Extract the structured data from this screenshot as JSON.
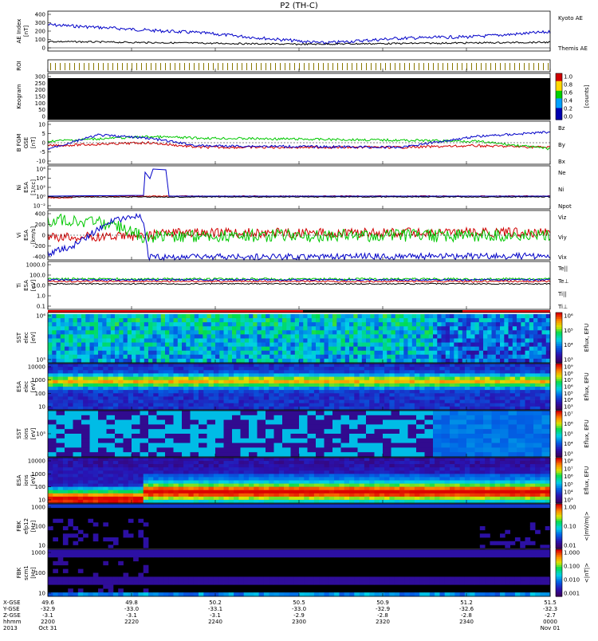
{
  "title": "P2 (TH-C)",
  "colors": {
    "red": "#d00000",
    "green": "#00c800",
    "blue": "#0000c8",
    "black": "#000000"
  },
  "panels": [
    {
      "id": "ae",
      "ylabel": [
        "AE Index",
        "[nT]"
      ],
      "ticks": [
        "400",
        "300",
        "200",
        "100",
        "0"
      ],
      "legend": [
        {
          "text": "Kyoto AE",
          "color": "#0000c8"
        },
        {
          "text": "Themis AE",
          "color": "#000000"
        }
      ]
    },
    {
      "id": "roi",
      "ylabel": [
        "ROI"
      ],
      "ticks": [],
      "legend": []
    },
    {
      "id": "keogram",
      "ylabel": [
        "Keogram"
      ],
      "ticks": [
        "300",
        "250",
        "200",
        "150",
        "100",
        "50",
        "0"
      ],
      "cbar_ticks": [
        "1.0",
        "0.8",
        "0.6",
        "0.4",
        "0.2",
        "0.0"
      ],
      "cbar_label": "[counts]",
      "legend": []
    },
    {
      "id": "bfgm",
      "ylabel": [
        "B FGM",
        "GSE",
        "[nT]"
      ],
      "ticks": [
        "10",
        "5",
        "0",
        "-5",
        "-10"
      ],
      "legend": [
        {
          "text": "Bz",
          "color": "#d00000"
        },
        {
          "text": "By",
          "color": "#00c800"
        },
        {
          "text": "Bx",
          "color": "#0000c8"
        }
      ]
    },
    {
      "id": "ni",
      "ylabel": [
        "Ni",
        "ESA",
        "[1/cc]"
      ],
      "ticks": [
        "10⁶",
        "10⁴",
        "10²",
        "10⁰",
        "10⁻²"
      ],
      "legend": [
        {
          "text": "Ne",
          "color": "#d00000"
        },
        {
          "text": "Ni",
          "color": "#000000"
        },
        {
          "text": "Npot",
          "color": "#0000c8"
        }
      ]
    },
    {
      "id": "vi",
      "ylabel": [
        "Vi",
        "ESA",
        "[km/s]"
      ],
      "ticks": [
        "400",
        "200",
        "0",
        "-200",
        "-400"
      ],
      "legend": [
        {
          "text": "Viz",
          "color": "#d00000"
        },
        {
          "text": "Viy",
          "color": "#00c800"
        },
        {
          "text": "Vix",
          "color": "#0000c8"
        }
      ]
    },
    {
      "id": "ti",
      "ylabel": [
        "Ti",
        "ESA",
        "[eV]"
      ],
      "ticks": [
        "1000.0",
        "100.0",
        "10.0",
        "1.0",
        "0.1"
      ],
      "legend": [
        {
          "text": "Te||",
          "color": "#000000"
        },
        {
          "text": "Te⊥",
          "color": "#d00000"
        },
        {
          "text": "Ti||",
          "color": "#00c800"
        },
        {
          "text": "Ti⊥",
          "color": "#0000c8"
        }
      ]
    },
    {
      "id": "sst_e",
      "ylabel": [
        "SST",
        "elec",
        "[eV]"
      ],
      "ticks": [
        "10⁶",
        "10⁵"
      ],
      "cbar_ticks": [
        "10⁶",
        "10⁵",
        "10⁴",
        "10³"
      ],
      "cbar_label": "Eflux, EFU",
      "legend": []
    },
    {
      "id": "esa_e",
      "ylabel": [
        "ESA",
        "elec",
        "[eV]"
      ],
      "ticks": [
        "10000",
        "1000",
        "100",
        "10"
      ],
      "cbar_ticks": [
        "10⁹",
        "10⁸",
        "10⁷",
        "10⁶",
        "10⁵",
        "10⁴",
        "10³"
      ],
      "cbar_label": "Eflux, EFU",
      "legend": []
    },
    {
      "id": "sst_i",
      "ylabel": [
        "SST",
        "ions",
        "[eV]"
      ],
      "ticks": [
        "10⁵"
      ],
      "cbar_ticks": [
        "10⁷",
        "10⁶",
        "10⁵",
        "10⁴",
        "10³"
      ],
      "cbar_label": "Eflux, EFU",
      "legend": []
    },
    {
      "id": "esa_i",
      "ylabel": [
        "ESA",
        "ions",
        "[eV]"
      ],
      "ticks": [
        "10000",
        "1000",
        "100",
        "10"
      ],
      "cbar_ticks": [
        "10⁸",
        "10⁷",
        "10⁶",
        "10⁵",
        "10⁴",
        "10³"
      ],
      "cbar_label": "Eflux, EFU",
      "legend": []
    },
    {
      "id": "fbk_e",
      "ylabel": [
        "FBK",
        "efp12",
        "[Hz]"
      ],
      "ticks": [
        "1000",
        "100",
        "10"
      ],
      "cbar_ticks": [
        "1.00",
        "0.10",
        "0.01"
      ],
      "cbar_label": "<|mV/m|>",
      "legend": []
    },
    {
      "id": "fbk_b",
      "ylabel": [
        "FBK",
        "scm1",
        "[Hz]"
      ],
      "ticks": [
        "1000",
        "100",
        "10"
      ],
      "cbar_ticks": [
        "1.000",
        "0.100",
        "0.010",
        "0.001"
      ],
      "cbar_label": "<|nT|>",
      "legend": []
    }
  ],
  "xaxis": {
    "row_labels": [
      "X-GSE",
      "Y-GSE",
      "Z-GSE",
      "hhmm",
      "2013"
    ],
    "columns": [
      [
        "49.6",
        "-32.9",
        "-3.1",
        "2200",
        "Oct 31"
      ],
      [
        "49.8",
        "-33.0",
        "-3.1",
        "2220",
        ""
      ],
      [
        "50.2",
        "-33.1",
        "-3.1",
        "2240",
        ""
      ],
      [
        "50.5",
        "-33.0",
        "-2.9",
        "2300",
        ""
      ],
      [
        "50.9",
        "-32.9",
        "-2.8",
        "2320",
        ""
      ],
      [
        "51.2",
        "-32.6",
        "-2.8",
        "2340",
        ""
      ],
      [
        "51.5",
        "-32.3",
        "-2.7",
        "0000",
        "Nov 01"
      ]
    ]
  },
  "chart_data": {
    "type": "line",
    "title": "P2 (TH-C)",
    "x_unit": "UT hhmm",
    "x_ticks": [
      "2200",
      "2220",
      "2240",
      "2300",
      "2320",
      "2340",
      "0000"
    ],
    "series": [
      {
        "panel": "AE Index",
        "name": "Kyoto AE",
        "x": [
          "2200",
          "2220",
          "2240",
          "2300",
          "2320",
          "2340",
          "0000"
        ],
        "values": [
          290,
          210,
          120,
          60,
          110,
          130,
          190
        ]
      },
      {
        "panel": "AE Index",
        "name": "Themis AE",
        "x": [
          "2200",
          "2220",
          "2240",
          "2300",
          "2320",
          "2340",
          "0000"
        ],
        "values": [
          80,
          70,
          60,
          40,
          60,
          60,
          70
        ]
      },
      {
        "panel": "B FGM",
        "name": "Bz",
        "x": [
          "2200",
          "2220",
          "2240",
          "2300",
          "2320",
          "2340",
          "0000"
        ],
        "values": [
          -1,
          -2,
          -3,
          -3,
          -3,
          -4,
          -2
        ]
      },
      {
        "panel": "B FGM",
        "name": "By",
        "x": [
          "2200",
          "2220",
          "2240",
          "2300",
          "2320",
          "2340",
          "0000"
        ],
        "values": [
          2,
          3,
          2,
          1,
          1,
          0,
          -4
        ]
      },
      {
        "panel": "B FGM",
        "name": "Bx",
        "x": [
          "2200",
          "2220",
          "2240",
          "2300",
          "2320",
          "2340",
          "0000"
        ],
        "values": [
          -2,
          -3,
          -3,
          -3,
          -2,
          3,
          6
        ]
      },
      {
        "panel": "Vi",
        "name": "Vix",
        "x": [
          "2200",
          "2220",
          "2240",
          "2300",
          "2320",
          "2340",
          "0000"
        ],
        "values": [
          -350,
          300,
          -400,
          -390,
          -390,
          -380,
          -370
        ]
      },
      {
        "panel": "Vi",
        "name": "Viy",
        "x": [
          "2200",
          "2220",
          "2240",
          "2300",
          "2320",
          "2340",
          "0000"
        ],
        "values": [
          250,
          150,
          -10,
          -10,
          -10,
          -10,
          0
        ]
      },
      {
        "panel": "Vi",
        "name": "Viz",
        "x": [
          "2200",
          "2220",
          "2240",
          "2300",
          "2320",
          "2340",
          "0000"
        ],
        "values": [
          -30,
          -20,
          30,
          40,
          40,
          40,
          50
        ]
      }
    ]
  }
}
